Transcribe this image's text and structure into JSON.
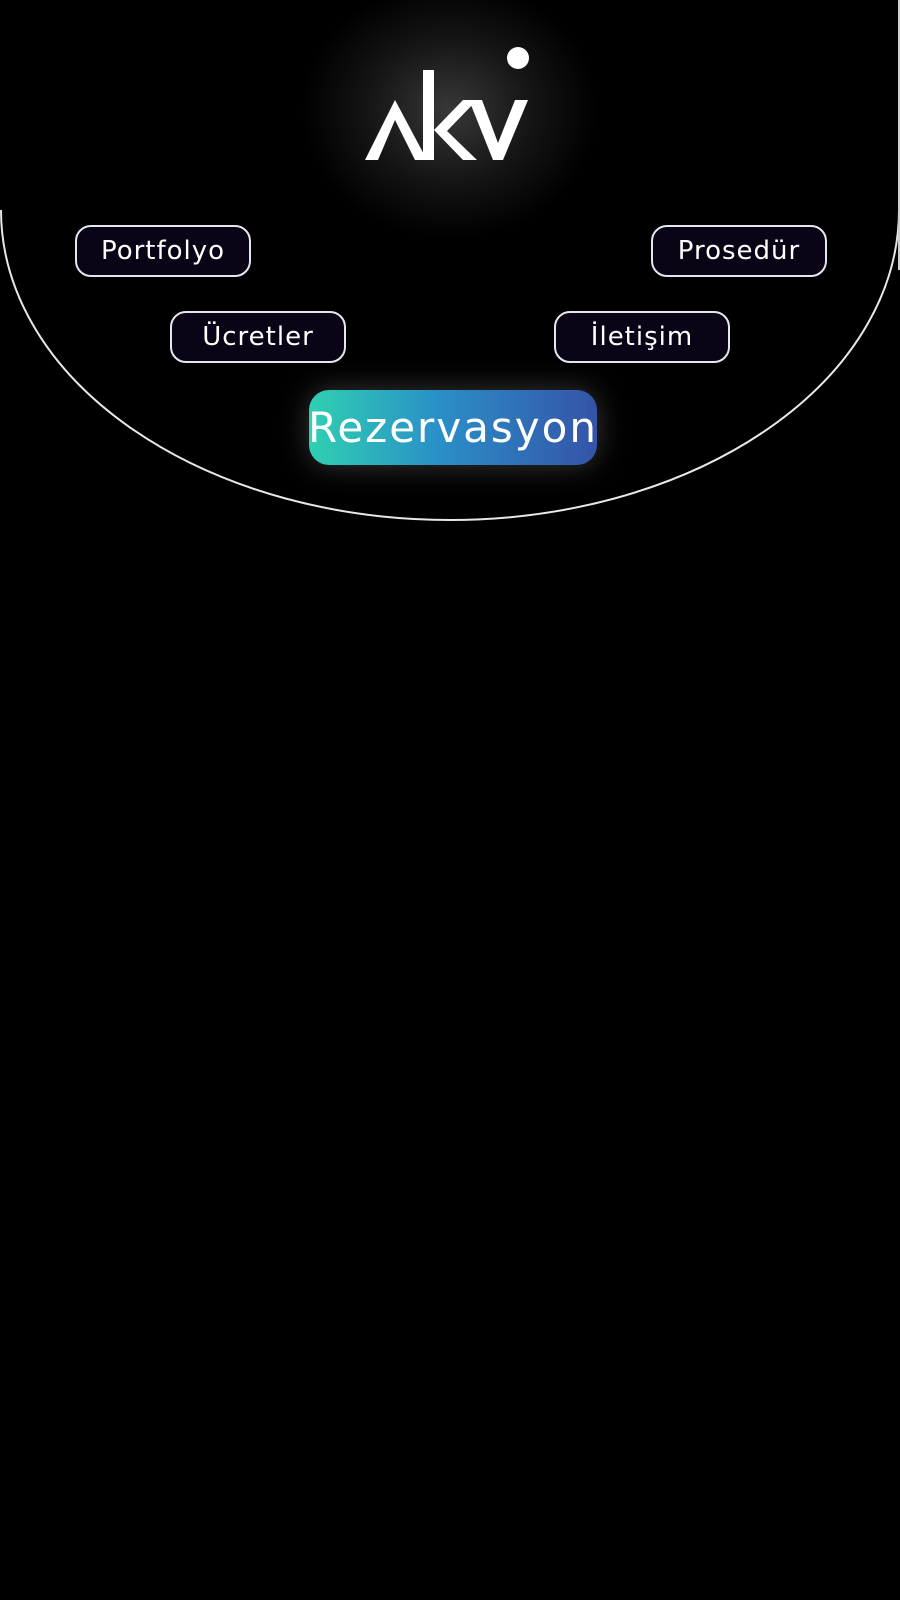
{
  "logo": {
    "text": "akv"
  },
  "nav": {
    "portfolio": "Portfolyo",
    "procedure": "Prosedür",
    "prices": "Ücretler",
    "contact": "İletişim"
  },
  "cta": {
    "label": "Rezervasyon"
  },
  "colors": {
    "background": "#000000",
    "button_fill": "#0a0416",
    "cta_start": "#2fd0b2",
    "cta_end": "#3553a8"
  }
}
